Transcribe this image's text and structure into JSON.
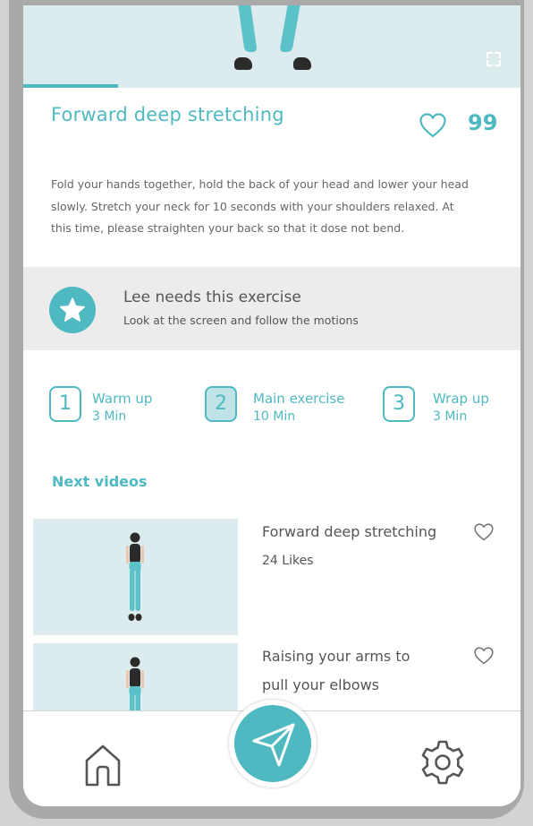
{
  "video": {
    "title": "Forward deep stretching",
    "likes": "99",
    "progress": 0.19,
    "description": "Fold your hands together, hold the back of your head and lower your head slowly. Stretch your neck for 10 seconds with your shoulders relaxed. At this time, please straighten your back so that it dose not bend."
  },
  "recommendation": {
    "title": "Lee needs this exercise",
    "subtitle": "Look at the screen and follow the motions"
  },
  "steps": [
    {
      "number": "1",
      "label": "Warm up",
      "duration": "3 Min",
      "active": false
    },
    {
      "number": "2",
      "label": "Main exercise",
      "duration": "10 Min",
      "active": true
    },
    {
      "number": "3",
      "label": "Wrap up",
      "duration": "3 Min",
      "active": false
    }
  ],
  "next_videos": {
    "heading": "Next videos",
    "items": [
      {
        "title": "Forward deep stretching",
        "likes": "24 Likes"
      },
      {
        "title_line1": "Raising your arms to",
        "title_line2": "pull your elbows"
      }
    ]
  },
  "nav": {
    "home": "home-icon",
    "center": "send-icon",
    "settings": "gear-icon"
  },
  "colors": {
    "accent": "#4fb9c2",
    "thumb_bg": "#dcebed",
    "banner_bg": "#ececec"
  }
}
